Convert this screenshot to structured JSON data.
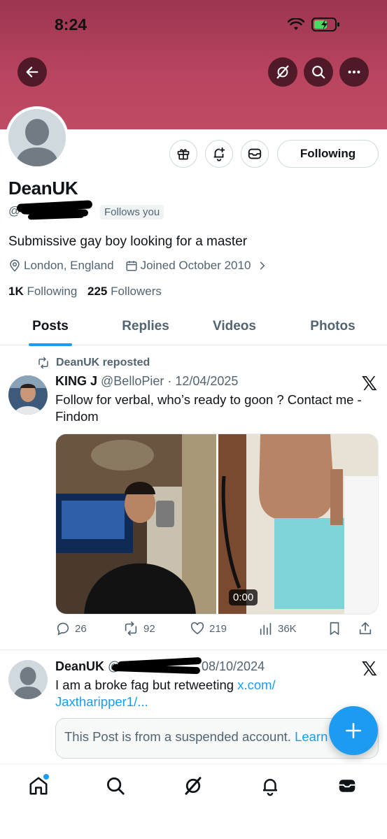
{
  "status_bar": {
    "time": "8:24"
  },
  "profile": {
    "display_name": "DeanUK",
    "handle_prefix": "@",
    "follows_you": "Follows you",
    "bio": "Submissive gay boy looking for a master",
    "location": "London, England",
    "joined": "Joined October 2010",
    "following_count": "1K",
    "following_label": "Following",
    "followers_count": "225",
    "followers_label": "Followers",
    "follow_button": "Following"
  },
  "tabs": [
    {
      "label": "Posts",
      "active": true
    },
    {
      "label": "Replies"
    },
    {
      "label": "Videos"
    },
    {
      "label": "Photos"
    }
  ],
  "posts": [
    {
      "repost_label": "DeanUK reposted",
      "author_name": "KING J",
      "author_handle": "@BelloPier",
      "date": "· 12/04/2025",
      "text": "Follow for verbal, who’s ready to goon ? Contact me - Findom",
      "video_duration": "0:00",
      "replies": "26",
      "reposts": "92",
      "likes": "219",
      "views": "36K"
    },
    {
      "author_name": "DeanUK",
      "author_handle": "@",
      "date": "08/10/2024",
      "text": "I am a broke fag but retweeting ",
      "link_text": "x.com/",
      "link_text_2": "Jaxtharipper1/...",
      "quote_text": "This Post is from a suspended account. ",
      "quote_link": "Learn more"
    }
  ],
  "colors": {
    "banner": "#b8445f",
    "accent": "#1d9bf0",
    "secondary_text": "#536471"
  }
}
